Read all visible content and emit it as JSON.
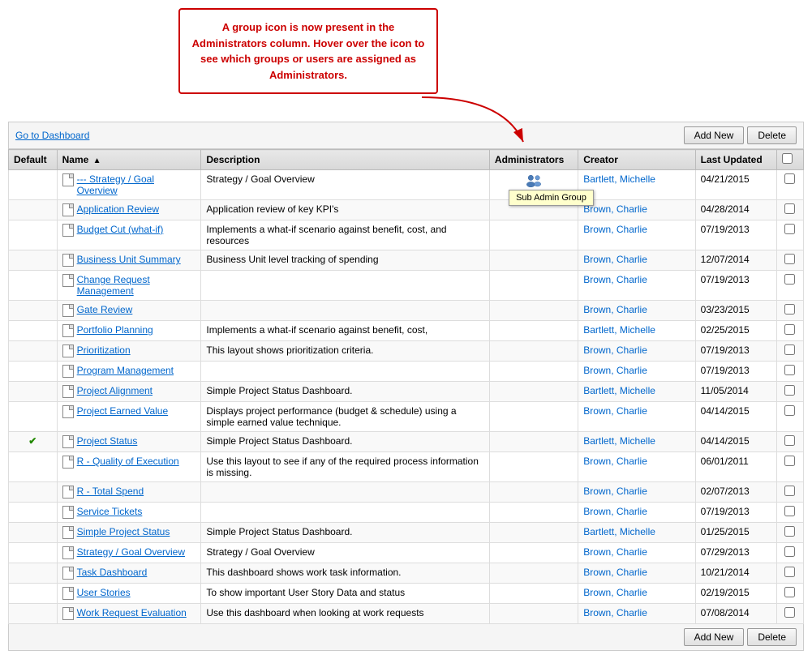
{
  "callout": {
    "text": "A group icon is now present in the Administrators column. Hover over the icon to see which groups or users are assigned as Administrators."
  },
  "toolbar": {
    "go_to_dashboard": "Go to Dashboard",
    "add_new": "Add New",
    "delete": "Delete"
  },
  "table": {
    "headers": {
      "default": "Default",
      "name": "Name",
      "description": "Description",
      "administrators": "Administrators",
      "creator": "Creator",
      "last_updated": "Last Updated"
    },
    "rows": [
      {
        "default": "",
        "name": "--- Strategy / Goal Overview",
        "description": "Strategy / Goal Overview",
        "admin_icon": true,
        "admin_tooltip": "Sub Admin Group",
        "creator": "Bartlett, Michelle",
        "last_updated": "04/21/2015",
        "checked": false
      },
      {
        "default": "",
        "name": "Application Review",
        "description": "Application review of key KPI's",
        "admin_icon": false,
        "admin_tooltip": "",
        "creator": "Brown, Charlie",
        "last_updated": "04/28/2014",
        "checked": false
      },
      {
        "default": "",
        "name": "Budget Cut (what-if)",
        "description": "Implements a what-if scenario against benefit, cost, and resources",
        "admin_icon": false,
        "admin_tooltip": "",
        "creator": "Brown, Charlie",
        "last_updated": "07/19/2013",
        "checked": false
      },
      {
        "default": "",
        "name": "Business Unit Summary",
        "description": "Business Unit level tracking of spending",
        "admin_icon": false,
        "admin_tooltip": "",
        "creator": "Brown, Charlie",
        "last_updated": "12/07/2014",
        "checked": false
      },
      {
        "default": "",
        "name": "Change Request Management",
        "description": "",
        "admin_icon": false,
        "admin_tooltip": "",
        "creator": "Brown, Charlie",
        "last_updated": "07/19/2013",
        "checked": false
      },
      {
        "default": "",
        "name": "Gate Review",
        "description": "",
        "admin_icon": false,
        "admin_tooltip": "",
        "creator": "Brown, Charlie",
        "last_updated": "03/23/2015",
        "checked": false
      },
      {
        "default": "",
        "name": "Portfolio Planning",
        "description": "Implements a what-if scenario against benefit, cost,",
        "admin_icon": false,
        "admin_tooltip": "",
        "creator": "Bartlett, Michelle",
        "last_updated": "02/25/2015",
        "checked": false
      },
      {
        "default": "",
        "name": "Prioritization",
        "description": "This layout shows prioritization criteria.",
        "admin_icon": false,
        "admin_tooltip": "",
        "creator": "Brown, Charlie",
        "last_updated": "07/19/2013",
        "checked": false
      },
      {
        "default": "",
        "name": "Program Management",
        "description": "",
        "admin_icon": false,
        "admin_tooltip": "",
        "creator": "Brown, Charlie",
        "last_updated": "07/19/2013",
        "checked": false
      },
      {
        "default": "",
        "name": "Project Alignment",
        "description": "Simple Project Status Dashboard.",
        "admin_icon": false,
        "admin_tooltip": "",
        "creator": "Bartlett, Michelle",
        "last_updated": "11/05/2014",
        "checked": false
      },
      {
        "default": "",
        "name": "Project Earned Value",
        "description": "Displays project performance (budget & schedule) using a simple earned value technique.",
        "admin_icon": false,
        "admin_tooltip": "",
        "creator": "Brown, Charlie",
        "last_updated": "04/14/2015",
        "checked": false
      },
      {
        "default": "✔",
        "name": "Project Status",
        "description": "Simple Project Status Dashboard.",
        "admin_icon": false,
        "admin_tooltip": "",
        "creator": "Bartlett, Michelle",
        "last_updated": "04/14/2015",
        "checked": false
      },
      {
        "default": "",
        "name": "R - Quality of Execution",
        "description": "Use this layout to see if any of the required process information is missing.",
        "admin_icon": false,
        "admin_tooltip": "",
        "creator": "Brown, Charlie",
        "last_updated": "06/01/2011",
        "checked": false
      },
      {
        "default": "",
        "name": "R - Total Spend",
        "description": "",
        "admin_icon": false,
        "admin_tooltip": "",
        "creator": "Brown, Charlie",
        "last_updated": "02/07/2013",
        "checked": false
      },
      {
        "default": "",
        "name": "Service Tickets",
        "description": "",
        "admin_icon": false,
        "admin_tooltip": "",
        "creator": "Brown, Charlie",
        "last_updated": "07/19/2013",
        "checked": false
      },
      {
        "default": "",
        "name": "Simple Project Status",
        "description": "Simple Project Status Dashboard.",
        "admin_icon": false,
        "admin_tooltip": "",
        "creator": "Bartlett, Michelle",
        "last_updated": "01/25/2015",
        "checked": false
      },
      {
        "default": "",
        "name": "Strategy / Goal Overview",
        "description": "Strategy / Goal Overview",
        "admin_icon": false,
        "admin_tooltip": "",
        "creator": "Brown, Charlie",
        "last_updated": "07/29/2013",
        "checked": false
      },
      {
        "default": "",
        "name": "Task Dashboard",
        "description": "This dashboard shows work task information.",
        "admin_icon": false,
        "admin_tooltip": "",
        "creator": "Brown, Charlie",
        "last_updated": "10/21/2014",
        "checked": false
      },
      {
        "default": "",
        "name": "User Stories",
        "description": "To show important User Story Data and status",
        "admin_icon": false,
        "admin_tooltip": "",
        "creator": "Brown, Charlie",
        "last_updated": "02/19/2015",
        "checked": false
      },
      {
        "default": "",
        "name": "Work Request Evaluation",
        "description": "Use this dashboard when looking at work requests",
        "admin_icon": false,
        "admin_tooltip": "",
        "creator": "Brown, Charlie",
        "last_updated": "07/08/2014",
        "checked": false
      }
    ]
  }
}
